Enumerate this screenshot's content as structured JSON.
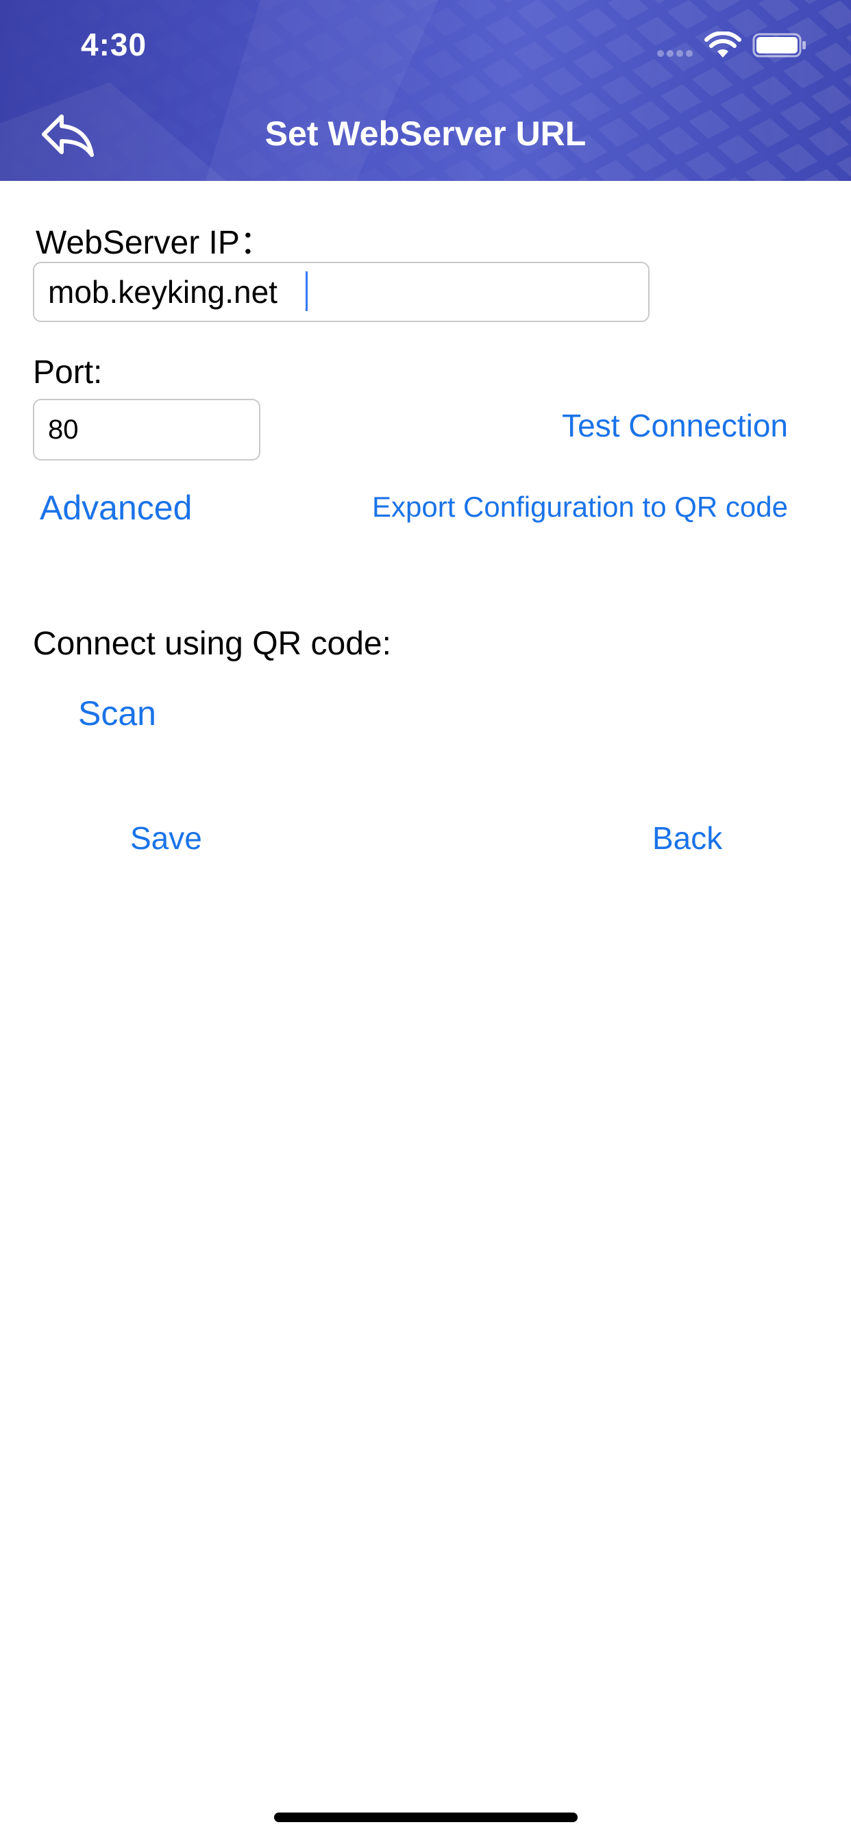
{
  "status_bar": {
    "time": "4:30"
  },
  "header": {
    "title": "Set WebServer URL",
    "back_icon": "reply-arrow-icon",
    "background_color": "#4a52c2"
  },
  "form": {
    "ip_label": "WebServer IP：",
    "ip_value": "mob.keyking.net",
    "port_label": "Port:",
    "port_value": "80",
    "test_connection_label": "Test Connection",
    "advanced_label": "Advanced",
    "export_label": "Export Configuration to QR code",
    "qr_label": "Connect using QR code:",
    "scan_label": "Scan"
  },
  "actions": {
    "save_label": "Save",
    "back_label": "Back"
  },
  "colors": {
    "link": "#1a73e8",
    "text": "#000000",
    "field_border": "#c9c9c9"
  }
}
